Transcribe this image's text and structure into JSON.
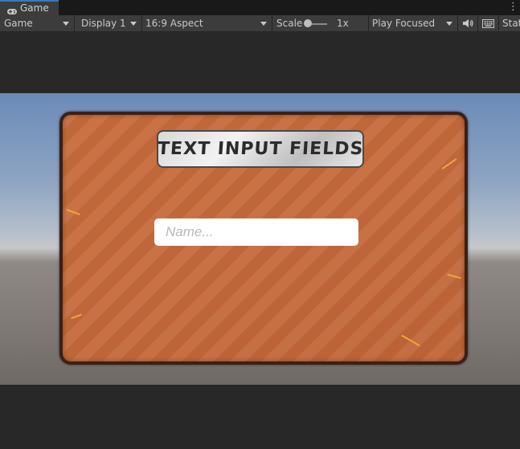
{
  "tab": {
    "label": "Game",
    "icon": "gamepad-icon"
  },
  "toolbar": {
    "game_view_select": "Game",
    "display_select": "Display 1",
    "aspect_select": "16:9 Aspect",
    "scale_label": "Scale",
    "scale_value": "1x",
    "scale_slider_level": 0,
    "play_mode_select": "Play Focused",
    "mute_icon": "speaker-icon",
    "stats_icon": "keyboard-icon",
    "stats_label": "Stat"
  },
  "scene": {
    "title": "TEXT INPUT FIELDS",
    "name_input": {
      "placeholder": "Name...",
      "value": ""
    }
  },
  "colors": {
    "panel": "#c76b3b",
    "panel_border": "#3b2016",
    "accent_tab": "#3a79bb",
    "editor_bg": "#282828",
    "toolbar_bg": "#3c3c3c"
  }
}
